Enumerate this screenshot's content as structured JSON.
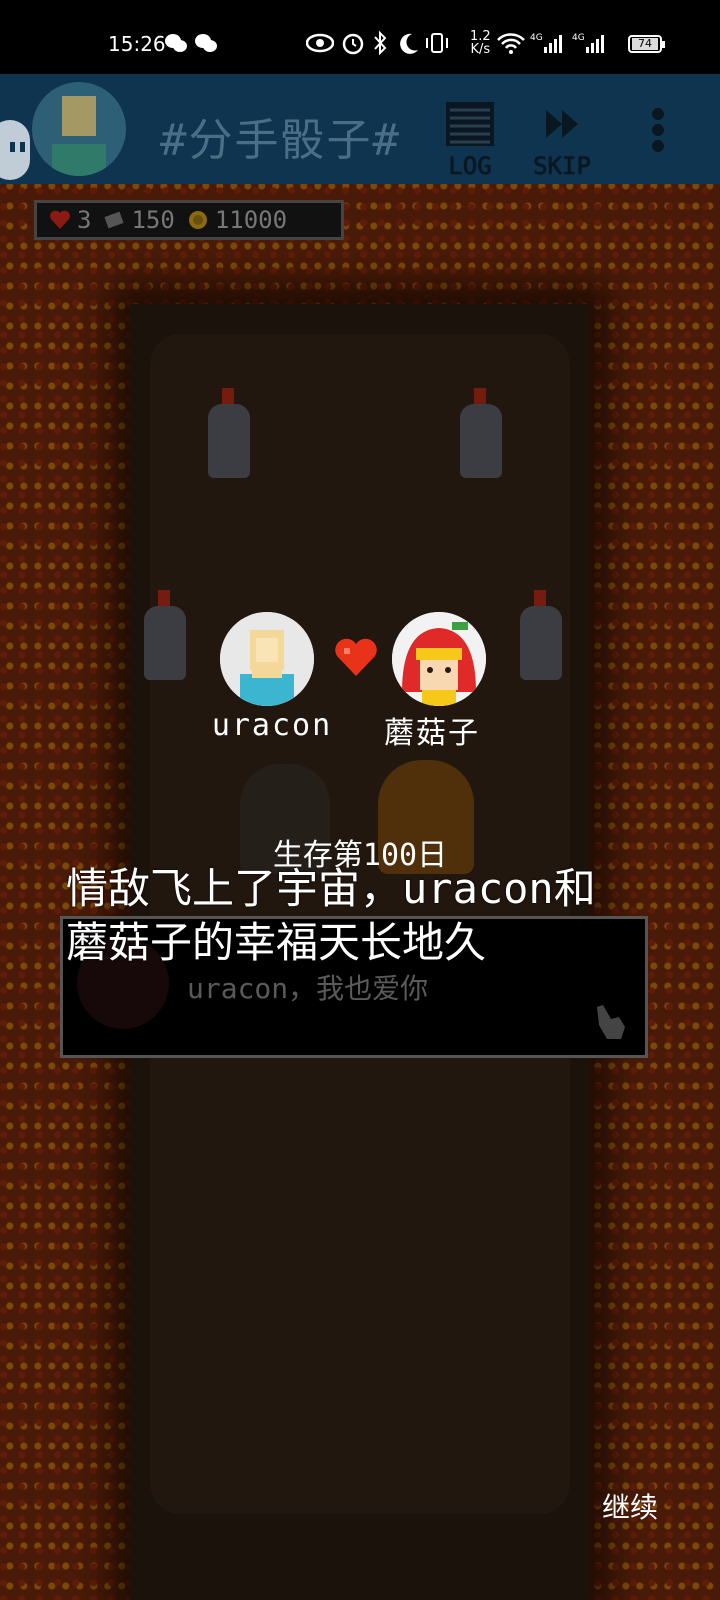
{
  "status_bar": {
    "time": "15:26",
    "net_speed": "1.2\nK/s",
    "battery": "74",
    "icons": [
      "wechat-icon",
      "wechat-icon",
      "eye-icon",
      "alarm-icon",
      "bluetooth-icon",
      "moon-icon",
      "vibrate-icon",
      "wifi-icon",
      "signal-4g-icon",
      "signal-4g-icon"
    ]
  },
  "top_bar": {
    "title": "#分手骰子#",
    "log_label": "LOG",
    "skip_label": "SKIP"
  },
  "stats": {
    "hearts": "3",
    "cards": "150",
    "coins": "11000"
  },
  "couple": {
    "left_name": "uracon",
    "right_name": "蘑菇子"
  },
  "day_text": "生存第100日",
  "story_text": "情敌飞上了宇宙，uracon和蘑菇子的幸福天长地久",
  "dialog": {
    "line": "uracon，我也爱你"
  },
  "continue_label": "继续",
  "colors": {
    "top_bar": "#0f3450",
    "lava": "#7a2d0e",
    "heart": "#e8321a"
  }
}
